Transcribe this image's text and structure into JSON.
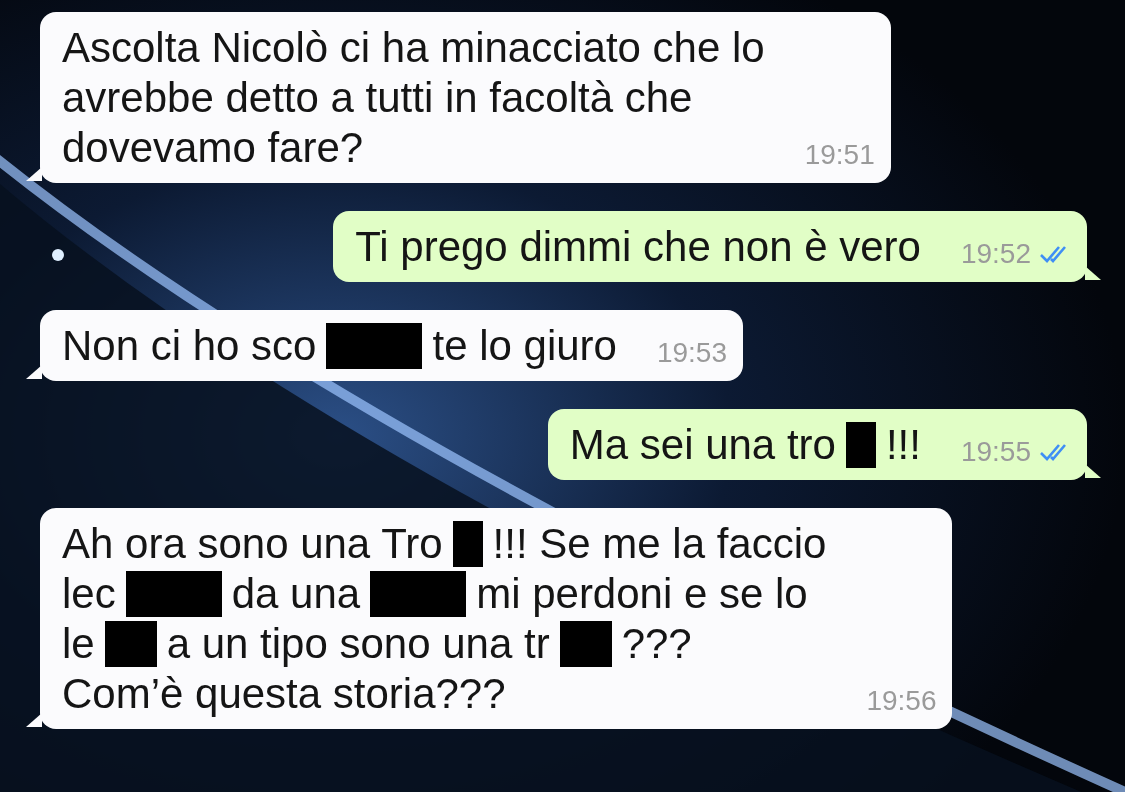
{
  "messages": [
    {
      "kind": "incoming",
      "time": "19:51",
      "lines": [
        [
          {
            "kind": "text",
            "text": "Ascolta Nicolò ci ha minacciato che lo"
          }
        ],
        [
          {
            "kind": "text",
            "text": "avrebbe detto a tutti in facoltà che"
          }
        ],
        [
          {
            "kind": "text",
            "text": "dovevamo fare?"
          }
        ]
      ]
    },
    {
      "kind": "outgoing",
      "time": "19:52",
      "read": true,
      "lines": [
        [
          {
            "kind": "text",
            "text": "Ti prego dimmi che non è vero"
          }
        ]
      ]
    },
    {
      "kind": "incoming",
      "time": "19:53",
      "lines": [
        [
          {
            "kind": "text",
            "text": "Non ci ho sco"
          },
          {
            "kind": "wide"
          },
          {
            "kind": "text",
            "text": "te lo giuro"
          }
        ]
      ]
    },
    {
      "kind": "outgoing",
      "time": "19:55",
      "read": true,
      "lines": [
        [
          {
            "kind": "text",
            "text": "Ma sei una tro"
          },
          {
            "kind": "narrow"
          },
          {
            "kind": "text",
            "text": "!!!"
          }
        ]
      ]
    },
    {
      "kind": "incoming",
      "time": "19:56",
      "lines": [
        [
          {
            "kind": "text",
            "text": "Ah ora sono una Tro"
          },
          {
            "kind": "narrow"
          },
          {
            "kind": "text",
            "text": "!!! Se me la faccio"
          }
        ],
        [
          {
            "kind": "text",
            "text": "lec"
          },
          {
            "kind": "wide"
          },
          {
            "kind": "text",
            "text": "da una"
          },
          {
            "kind": "wide"
          },
          {
            "kind": "text",
            "text": "mi perdoni e se lo"
          }
        ],
        [
          {
            "kind": "text",
            "text": "le"
          },
          {
            "kind": "medium"
          },
          {
            "kind": "text",
            "text": "a un tipo sono una tr"
          },
          {
            "kind": "medium"
          },
          {
            "kind": "text",
            "text": "???"
          }
        ],
        [
          {
            "kind": "text",
            "text": "Com’è questa storia???"
          }
        ]
      ]
    }
  ]
}
